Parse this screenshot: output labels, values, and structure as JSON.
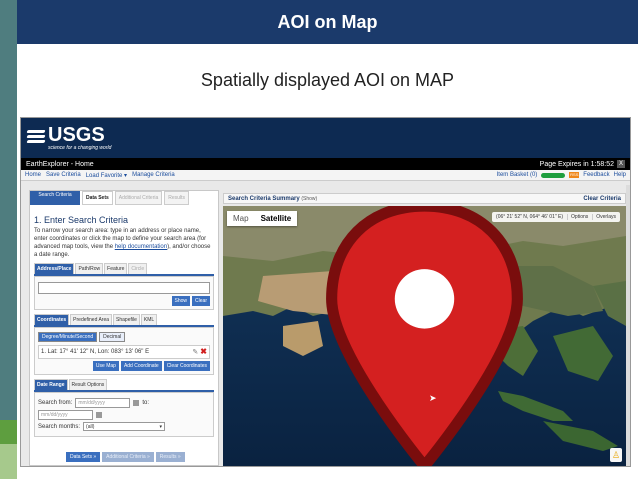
{
  "slide": {
    "title": "AOI on Map",
    "subtitle": "Spatially displayed AOI on MAP"
  },
  "usgs": {
    "logo": "USGS",
    "tagline": "science for a changing world"
  },
  "ee_bar": {
    "title": "EarthExplorer - Home",
    "expiry": "Page Expires in 1:58:52",
    "close": "X"
  },
  "nav": {
    "links": [
      "Home",
      "Save Criteria",
      "Load Favorite ▾",
      "Manage Criteria"
    ],
    "item_basket": "Item Basket (0)",
    "rss": "RSS",
    "feedback": "Feedback",
    "help": "Help"
  },
  "panel": {
    "tab_search_criteria": "Search Criteria",
    "tabs": [
      "Data Sets",
      "Additional Criteria",
      "Results"
    ],
    "step_title": "1. Enter Search Criteria",
    "step_desc_1": "To narrow your search area: type in an address or place name, enter coordinates or click the map to define your search area (for advanced map tools, view the ",
    "step_desc_link": "help documentation",
    "step_desc_2": "), and/or choose a date range.",
    "address_tabs": [
      "Address/Place",
      "Path/Row",
      "Feature",
      "Circle"
    ],
    "show_btn": "Show",
    "clear_btn": "Clear",
    "coord_tabs": [
      "Coordinates",
      "Predefined Area",
      "Shapefile",
      "KML"
    ],
    "coord_types": [
      "Degree/Minute/Second",
      "Decimal"
    ],
    "coord_entry": "1.  Lat: 17° 41' 12\" N, Lon: 083° 13' 06\" E",
    "use_map": "Use Map",
    "add_coordinate": "Add Coordinate",
    "clear_coordinates": "Clear Coordinates",
    "date_tabs": [
      "Date Range",
      "Result Options"
    ],
    "search_from": "Search from:",
    "date_placeholder": "mm/dd/yyyy",
    "to": "to:",
    "search_months": "Search months:",
    "months_value": "(all)",
    "bottom_buttons": [
      "Data Sets »",
      "Additional Criteria »",
      "Results »"
    ]
  },
  "summary": {
    "title": "Search Criteria Summary",
    "show": "(Show)",
    "clear": "Clear Criteria"
  },
  "map": {
    "types": [
      "Map",
      "Satellite"
    ],
    "active_type": "Satellite",
    "readout": "(06° 21' 52\" N, 064° 46' 01\" E)",
    "options": "Options",
    "overlays": "Overlays"
  },
  "colors": {
    "title_bar": "#1b3a6b",
    "usgs_bar": "#0d2a52",
    "aoi_box": "#f2e60a",
    "marker": "#d42020",
    "accent": "#2f5fa8"
  }
}
